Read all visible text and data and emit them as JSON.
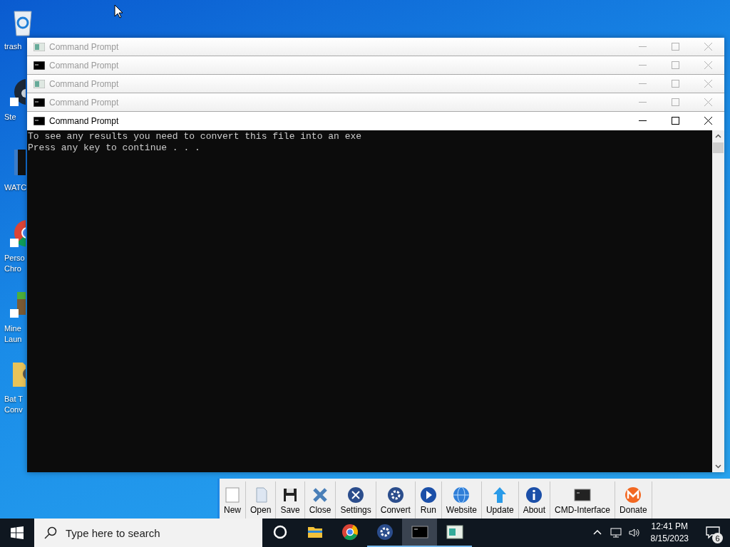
{
  "desktop": {
    "icons": [
      {
        "kind": "recycle",
        "label_lines": [
          "trash"
        ]
      },
      {
        "kind": "steam",
        "label_lines": [
          "Ste"
        ]
      },
      {
        "kind": "video",
        "label_lines": [
          "WATC"
        ]
      },
      {
        "kind": "chrome",
        "label_lines": [
          "Perso",
          "Chro"
        ]
      },
      {
        "kind": "minecraft",
        "label_lines": [
          "Mine",
          "Laun"
        ]
      },
      {
        "kind": "folder",
        "label_lines": [
          "Bat T",
          "Conv"
        ]
      }
    ]
  },
  "background_app": {
    "toolbar": [
      {
        "kind": "new",
        "label": "New"
      },
      {
        "kind": "open",
        "label": "Open"
      },
      {
        "kind": "save",
        "label": "Save"
      },
      {
        "kind": "close",
        "label": "Close"
      },
      {
        "kind": "settings",
        "label": "Settings"
      },
      {
        "kind": "convert",
        "label": "Convert"
      },
      {
        "kind": "run",
        "label": "Run"
      },
      {
        "kind": "website",
        "label": "Website"
      },
      {
        "kind": "update",
        "label": "Update"
      },
      {
        "kind": "about",
        "label": "About"
      },
      {
        "kind": "cmd",
        "label": "CMD-Interface"
      },
      {
        "kind": "donate",
        "label": "Donate"
      }
    ]
  },
  "windows": [
    {
      "title": "Command Prompt",
      "active": false,
      "kind": "generic"
    },
    {
      "title": "Command Prompt",
      "active": false,
      "kind": "cmd"
    },
    {
      "title": "Command Prompt",
      "active": false,
      "kind": "generic"
    },
    {
      "title": "Command Prompt",
      "active": false,
      "kind": "cmd"
    },
    {
      "title": "Command Prompt",
      "active": true,
      "kind": "cmd"
    }
  ],
  "console": {
    "lines": [
      "To see any results you need to convert this file into an exe",
      "Press any key to continue . . ."
    ]
  },
  "taskbar": {
    "search": {
      "placeholder": "Type here to search"
    },
    "apps": [
      {
        "kind": "cortana",
        "selected": false,
        "running": false
      },
      {
        "kind": "explorer",
        "selected": false,
        "running": false
      },
      {
        "kind": "chrome",
        "selected": false,
        "running": false
      },
      {
        "kind": "gear",
        "selected": false,
        "running": true
      },
      {
        "kind": "cmd",
        "selected": true,
        "running": true
      },
      {
        "kind": "app",
        "selected": false,
        "running": true
      }
    ],
    "clock": {
      "time": "12:41 PM",
      "date": "8/15/2023"
    },
    "notifications": {
      "count": "6"
    }
  }
}
